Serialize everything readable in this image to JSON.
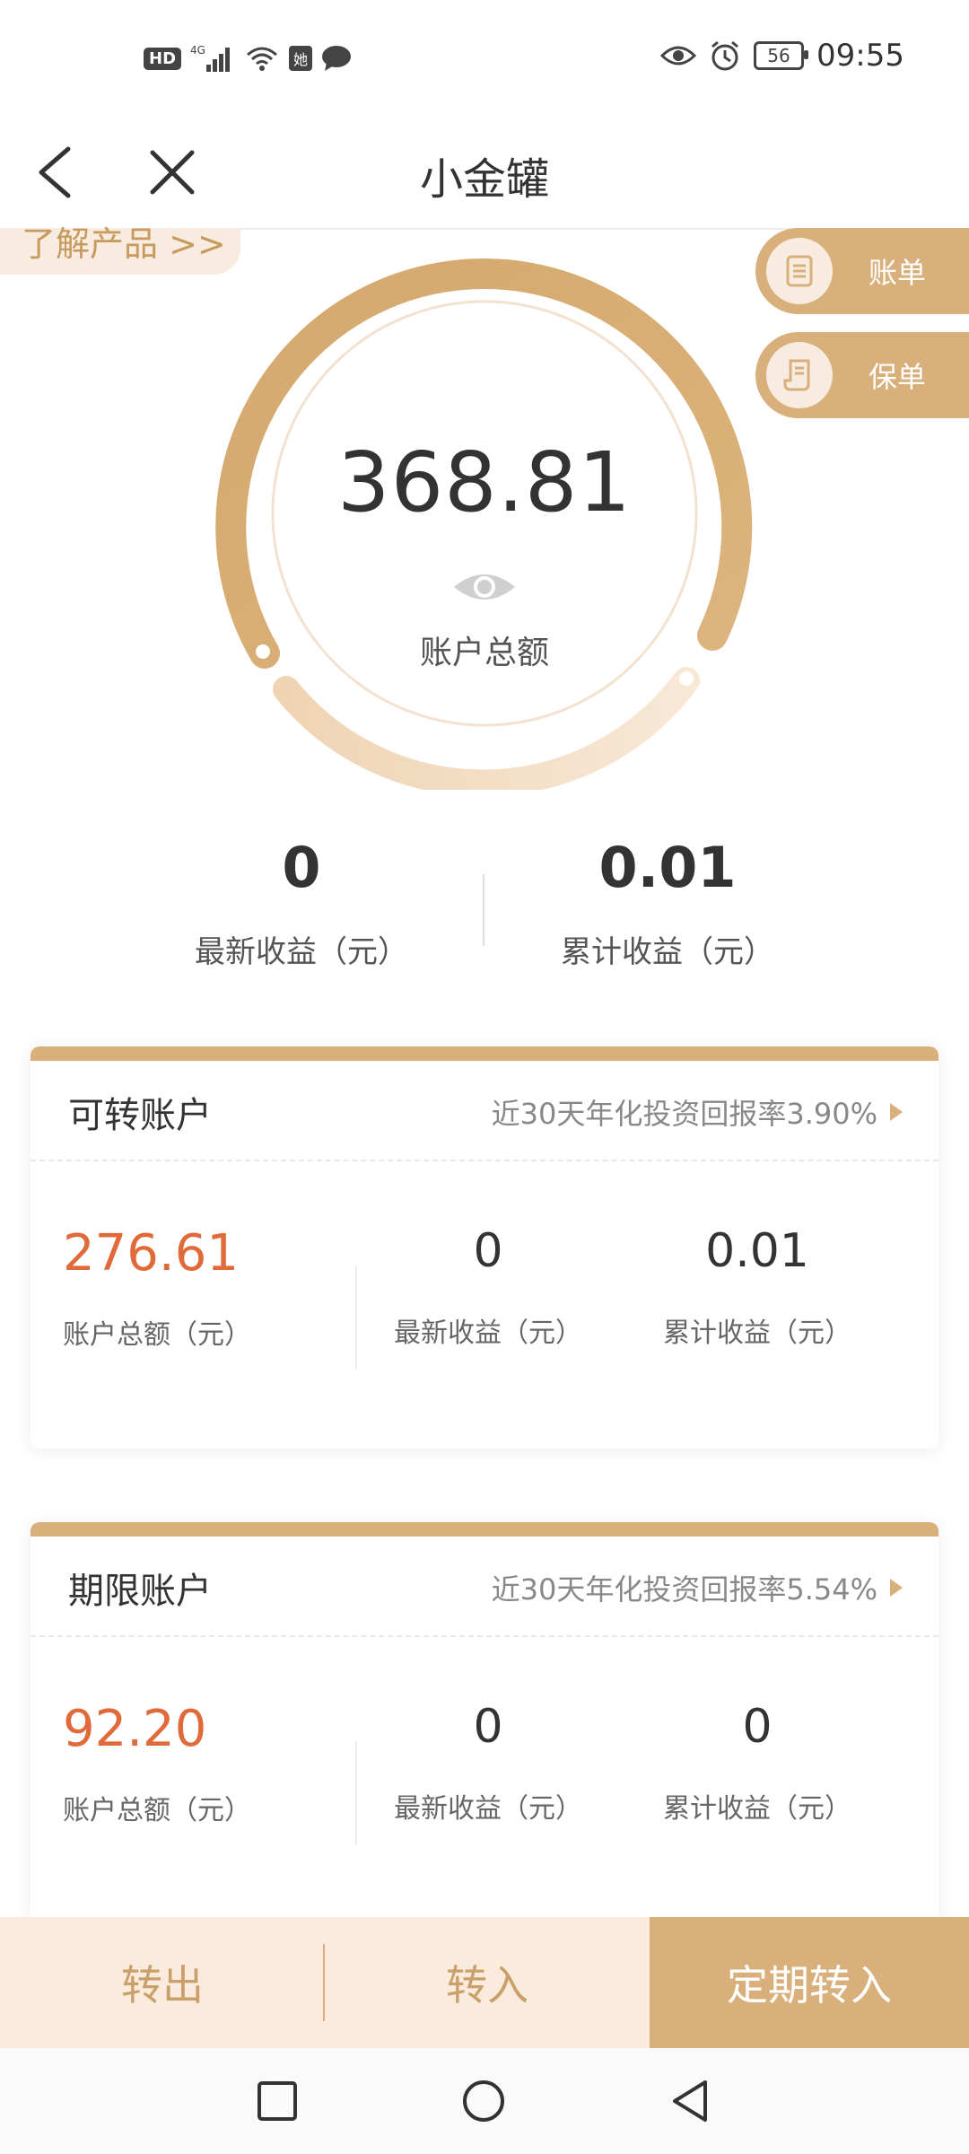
{
  "status_bar": {
    "hd": "HD",
    "network": "4G",
    "time": "09:55",
    "battery": "56"
  },
  "title_bar": {
    "title": "小金罐"
  },
  "hero": {
    "learn_product": "了解产品 >>",
    "bill_label": "账单",
    "policy_label": "保单",
    "total_amount": "368.81",
    "total_label": "账户总额"
  },
  "summary": {
    "latest_value": "0",
    "latest_label": "最新收益（元）",
    "cumulative_value": "0.01",
    "cumulative_label": "累计收益（元）"
  },
  "cards": [
    {
      "title": "可转账户",
      "rate": "近30天年化投资回报率3.90%",
      "total": "276.61",
      "total_label": "账户总额（元）",
      "latest": "0",
      "latest_label": "最新收益（元）",
      "cumulative": "0.01",
      "cumulative_label": "累计收益（元）"
    },
    {
      "title": "期限账户",
      "rate": "近30天年化投资回报率5.54%",
      "total": "92.20",
      "total_label": "账户总额（元）",
      "latest": "0",
      "latest_label": "最新收益（元）",
      "cumulative": "0",
      "cumulative_label": "累计收益（元）"
    }
  ],
  "actions": {
    "out": "转出",
    "in": "转入",
    "scheduled": "定期转入"
  },
  "colors": {
    "gold": "#d9b07c",
    "light_gold": "#faebdc",
    "accent_red": "#e06a3a"
  }
}
